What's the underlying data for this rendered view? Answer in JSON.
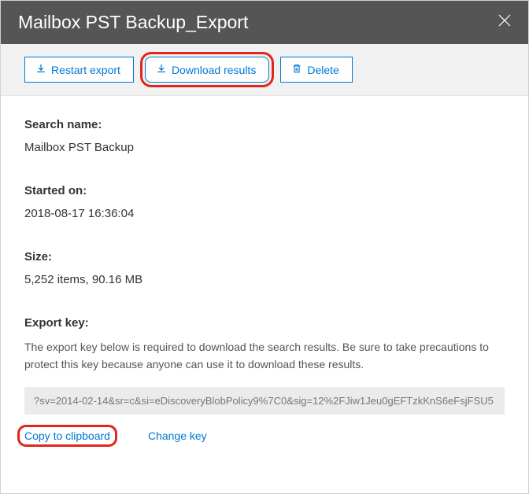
{
  "header": {
    "title": "Mailbox PST Backup_Export"
  },
  "toolbar": {
    "restart_label": "Restart export",
    "download_label": "Download results",
    "delete_label": "Delete"
  },
  "search_name": {
    "label": "Search name:",
    "value": "Mailbox PST Backup"
  },
  "started_on": {
    "label": "Started on:",
    "value": "2018-08-17 16:36:04"
  },
  "size": {
    "label": "Size:",
    "value": "5,252 items, 90.16 MB"
  },
  "export_key": {
    "label": "Export key:",
    "description": "The export key below is required to download the search results. Be sure to take precautions to protect this key because anyone can use it to download these results.",
    "key_value": "?sv=2014-02-14&sr=c&si=eDiscoveryBlobPolicy9%7C0&sig=12%2FJiw1Jeu0gEFTzkKnS6eFsjFSU5",
    "copy_label": "Copy to clipboard",
    "change_label": "Change key"
  }
}
